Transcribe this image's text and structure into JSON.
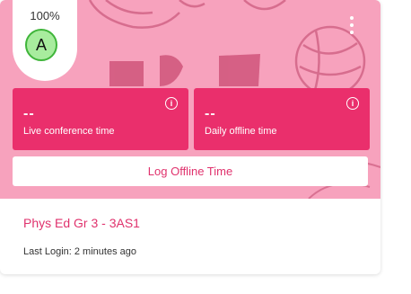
{
  "grade": {
    "percent": "100%",
    "letter": "A"
  },
  "stats": [
    {
      "value": "--",
      "label": "Live conference time",
      "icon": "info-icon"
    },
    {
      "value": "--",
      "label": "Daily offline time",
      "icon": "info-icon"
    }
  ],
  "actions": {
    "log_offline_label": "Log Offline Time"
  },
  "course": {
    "title": "Phys Ed Gr 3 - 3AS1",
    "last_login": "Last Login: 2 minutes ago"
  },
  "colors": {
    "accent": "#ea2f6c",
    "cover": "#f7a2bd",
    "grade_fill": "#a8ec9e",
    "grade_border": "#3fb53a"
  }
}
